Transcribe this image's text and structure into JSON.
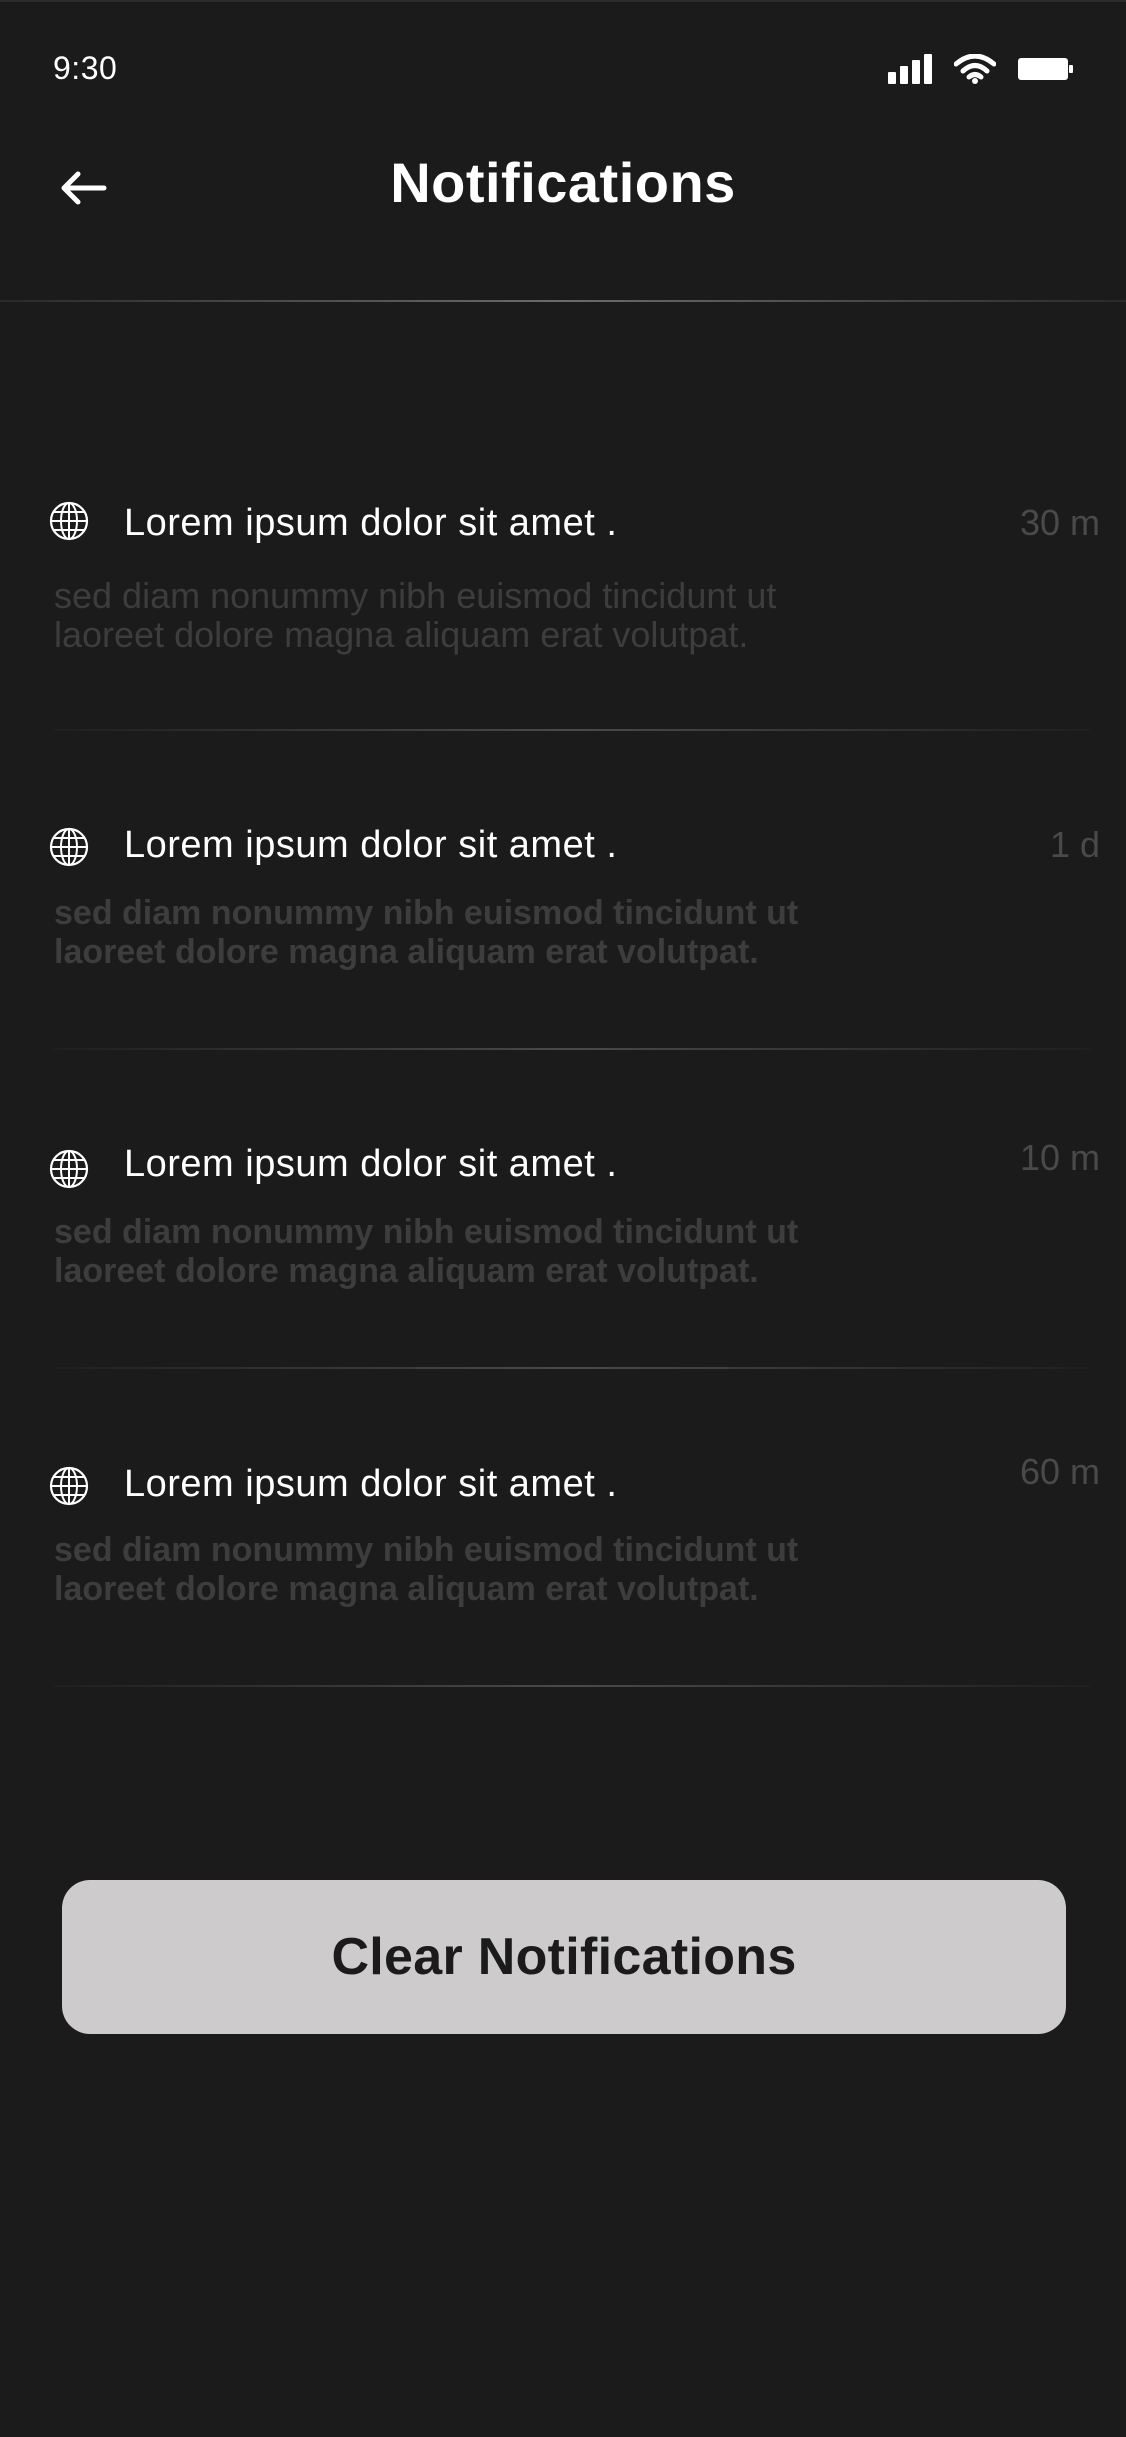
{
  "status_bar": {
    "time": "9:30",
    "icons": [
      "signal-icon",
      "wifi-icon",
      "battery-icon"
    ]
  },
  "header": {
    "title": "Notifications",
    "back_icon": "arrow-left-icon"
  },
  "notifications": [
    {
      "icon": "globe-icon",
      "title": "Lorem ipsum dolor sit amet .",
      "time": "30 m",
      "body_line1": "sed diam nonummy nibh euismod tincidunt ut",
      "body_line2": "laoreet dolore magna aliquam erat volutpat."
    },
    {
      "icon": "globe-icon",
      "title": "Lorem ipsum dolor sit amet .",
      "time": "1 d",
      "body_line1": "sed diam nonummy nibh euismod tincidunt ut",
      "body_line2": "laoreet dolore magna aliquam erat volutpat."
    },
    {
      "icon": "globe-icon",
      "title": "Lorem ipsum dolor sit amet .",
      "time": "10 m",
      "body_line1": "sed diam nonummy nibh euismod tincidunt ut",
      "body_line2": "laoreet dolore magna aliquam erat volutpat."
    },
    {
      "icon": "globe-icon",
      "title": "Lorem ipsum dolor sit amet .",
      "time": "60 m",
      "body_line1": "sed diam nonummy nibh euismod tincidunt ut",
      "body_line2": "laoreet dolore magna aliquam erat volutpat."
    }
  ],
  "actions": {
    "clear_label": "Clear Notifications"
  },
  "colors": {
    "background": "#1b1b1b",
    "button": "#cdcbcb",
    "muted_text": "#3d3d3d",
    "time_text": "#4a4a4a"
  }
}
